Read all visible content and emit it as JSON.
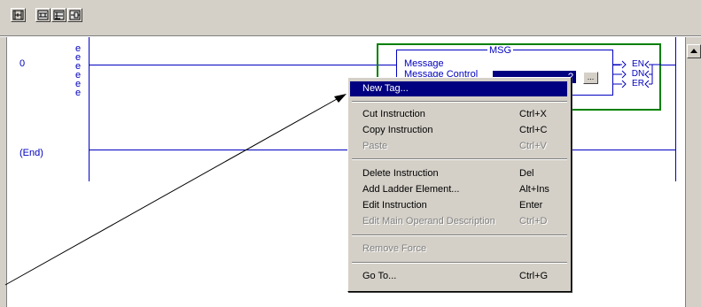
{
  "toolbar": {
    "buttons": [
      {
        "name": "rung-icon"
      },
      {
        "name": "branch-icon"
      },
      {
        "name": "branch-level-icon"
      },
      {
        "name": "output-icon"
      }
    ]
  },
  "ladder": {
    "rung_number": "0",
    "end_label": "(End)",
    "rung_marks": [
      "e",
      "e",
      "e",
      "e",
      "e",
      "e"
    ]
  },
  "msg_instruction": {
    "title": "MSG",
    "type_label": "Message",
    "control_label": "Message Control",
    "control_value": "?",
    "browse_button": "...",
    "outputs": [
      "EN",
      "DN",
      "ER"
    ]
  },
  "context_menu": {
    "items": [
      {
        "label": "New Tag...",
        "key": "",
        "state": "highlighted"
      },
      {
        "label": "Cut Instruction",
        "key": "Ctrl+X",
        "state": "enabled"
      },
      {
        "label": "Copy Instruction",
        "key": "Ctrl+C",
        "state": "enabled"
      },
      {
        "label": "Paste",
        "key": "Ctrl+V",
        "state": "disabled"
      },
      {
        "label": "Delete Instruction",
        "key": "Del",
        "state": "enabled"
      },
      {
        "label": "Add Ladder Element...",
        "key": "Alt+Ins",
        "state": "enabled"
      },
      {
        "label": "Edit Instruction",
        "key": "Enter",
        "state": "enabled"
      },
      {
        "label": "Edit Main Operand Description",
        "key": "Ctrl+D",
        "state": "disabled"
      },
      {
        "label": "Remove Force",
        "key": "",
        "state": "disabled"
      },
      {
        "label": "Go To...",
        "key": "Ctrl+G",
        "state": "enabled"
      }
    ]
  },
  "colors": {
    "rail": "#0000c0",
    "selection": "#000080",
    "selected_border": "#008000",
    "window_face": "#d4d0c8"
  }
}
